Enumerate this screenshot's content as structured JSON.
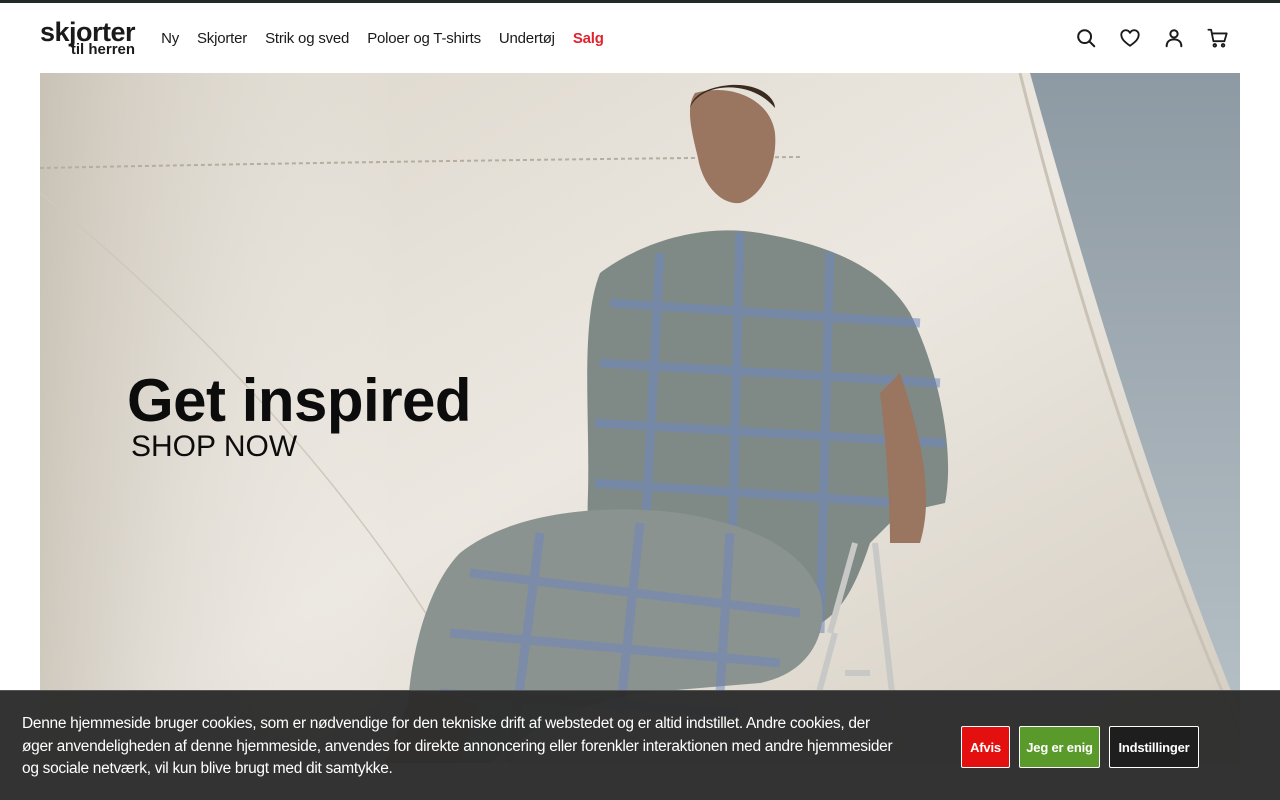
{
  "brand": {
    "line1": "skjorter",
    "line2": "til herren"
  },
  "nav": {
    "items": [
      {
        "label": "Ny"
      },
      {
        "label": "Skjorter"
      },
      {
        "label": "Strik og sved"
      },
      {
        "label": "Poloer og T-shirts"
      },
      {
        "label": "Undertøj"
      },
      {
        "label": "Salg"
      }
    ],
    "sale_color": "#e2232f"
  },
  "header_icons": [
    "search-icon",
    "heart-icon",
    "user-icon",
    "cart-icon"
  ],
  "hero": {
    "title": "Get inspired",
    "cta": "SHOP NOW"
  },
  "cookie": {
    "text": "Denne hjemmeside bruger cookies, som er nødvendige for den tekniske drift af webstedet og er altid indstillet. Andre cookies, der øger anvendeligheden af denne hjemmeside, anvendes for direkte annoncering eller forenkler interaktionen med andre hjemmesider og sociale netværk, vil kun blive brugt med dit samtykke.",
    "reject": "Afvis",
    "accept": "Jeg er enig",
    "settings": "Indstillinger",
    "colors": {
      "reject": "#e3100f",
      "accept": "#5a9a2b",
      "settings": "#1e1e1e"
    }
  }
}
